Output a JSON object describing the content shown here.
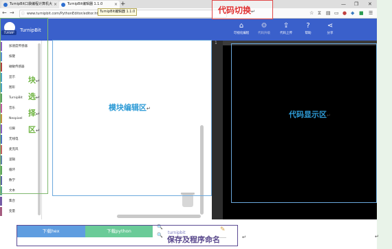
{
  "browser": {
    "tabs": [
      {
        "title": "TurnipBit口袋编程计算机大",
        "active": false
      },
      {
        "title": "TurnipBit编辑器 1.1.0",
        "active": true
      }
    ],
    "new_tab": "+",
    "url": "www.turnipbit.com/PythonEditor/editor.html#",
    "tooltip": "TurnipBit编辑器 1.1.0",
    "nav_back": "←",
    "nav_forward": "→",
    "nav_refresh": "↻",
    "toolbar_icons": [
      "star-icon",
      "history-icon",
      "library-icon",
      "sidebar-icon",
      "extension-icon",
      "extension-icon",
      "extension-icon",
      "menu-icon"
    ],
    "window_controls": [
      "—",
      "❐",
      "✕"
    ]
  },
  "app": {
    "logo_text": "TURNIP",
    "brand": "TurnipBit",
    "nav": [
      {
        "label": "可视化编程",
        "icon": "home-icon",
        "active": true
      },
      {
        "label": "代码升级",
        "icon": "gear-icon",
        "active": false
      },
      {
        "label": "代码上传",
        "icon": "upload-icon",
        "active": true
      },
      {
        "label": "帮助",
        "icon": "help-icon",
        "active": true
      },
      {
        "label": "分享",
        "icon": "share-icon",
        "active": true
      }
    ]
  },
  "categories": [
    {
      "label": "加速度传感器",
      "color": "#8a5cc0"
    },
    {
      "label": "按键",
      "color": "#5a8fd0"
    },
    {
      "label": "磁敏传感器",
      "color": "#b04040"
    },
    {
      "label": "显示",
      "color": "#4aa0c0"
    },
    {
      "label": "图形",
      "color": "#4aa0c0"
    },
    {
      "label": "TurnipBit",
      "color": "#5aa060"
    },
    {
      "label": "音乐",
      "color": "#c05aa0"
    },
    {
      "label": "Neopixel",
      "color": "#c09040"
    },
    {
      "label": "引脚",
      "color": "#8a5cc0"
    },
    {
      "label": "无线电",
      "color": "#4a70c0"
    },
    {
      "label": "麦克风",
      "color": "#c06060"
    },
    {
      "label": "逻辑",
      "color": "#5b80a5"
    },
    {
      "label": "循环",
      "color": "#5ba55b"
    },
    {
      "label": "数学",
      "color": "#5b67a5"
    },
    {
      "label": "文本",
      "color": "#5ba58c"
    },
    {
      "label": "集合",
      "color": "#745ba5"
    },
    {
      "label": "变量",
      "color": "#a55b80"
    }
  ],
  "code": {
    "line_number": "1"
  },
  "bottom": {
    "download_hex": "下载hex",
    "download_python": "下载python",
    "filename": "turnipbit",
    "zoom_in": "🔍",
    "zoom_out": "🔍"
  },
  "annotations": {
    "code_switch": "代码切换",
    "blocks_chars": [
      "块",
      "选",
      "择",
      "区"
    ],
    "workspace": "模块编辑区",
    "code_display": "代码显示区",
    "save": "保存及程序命名",
    "pilcrow": "↵"
  }
}
